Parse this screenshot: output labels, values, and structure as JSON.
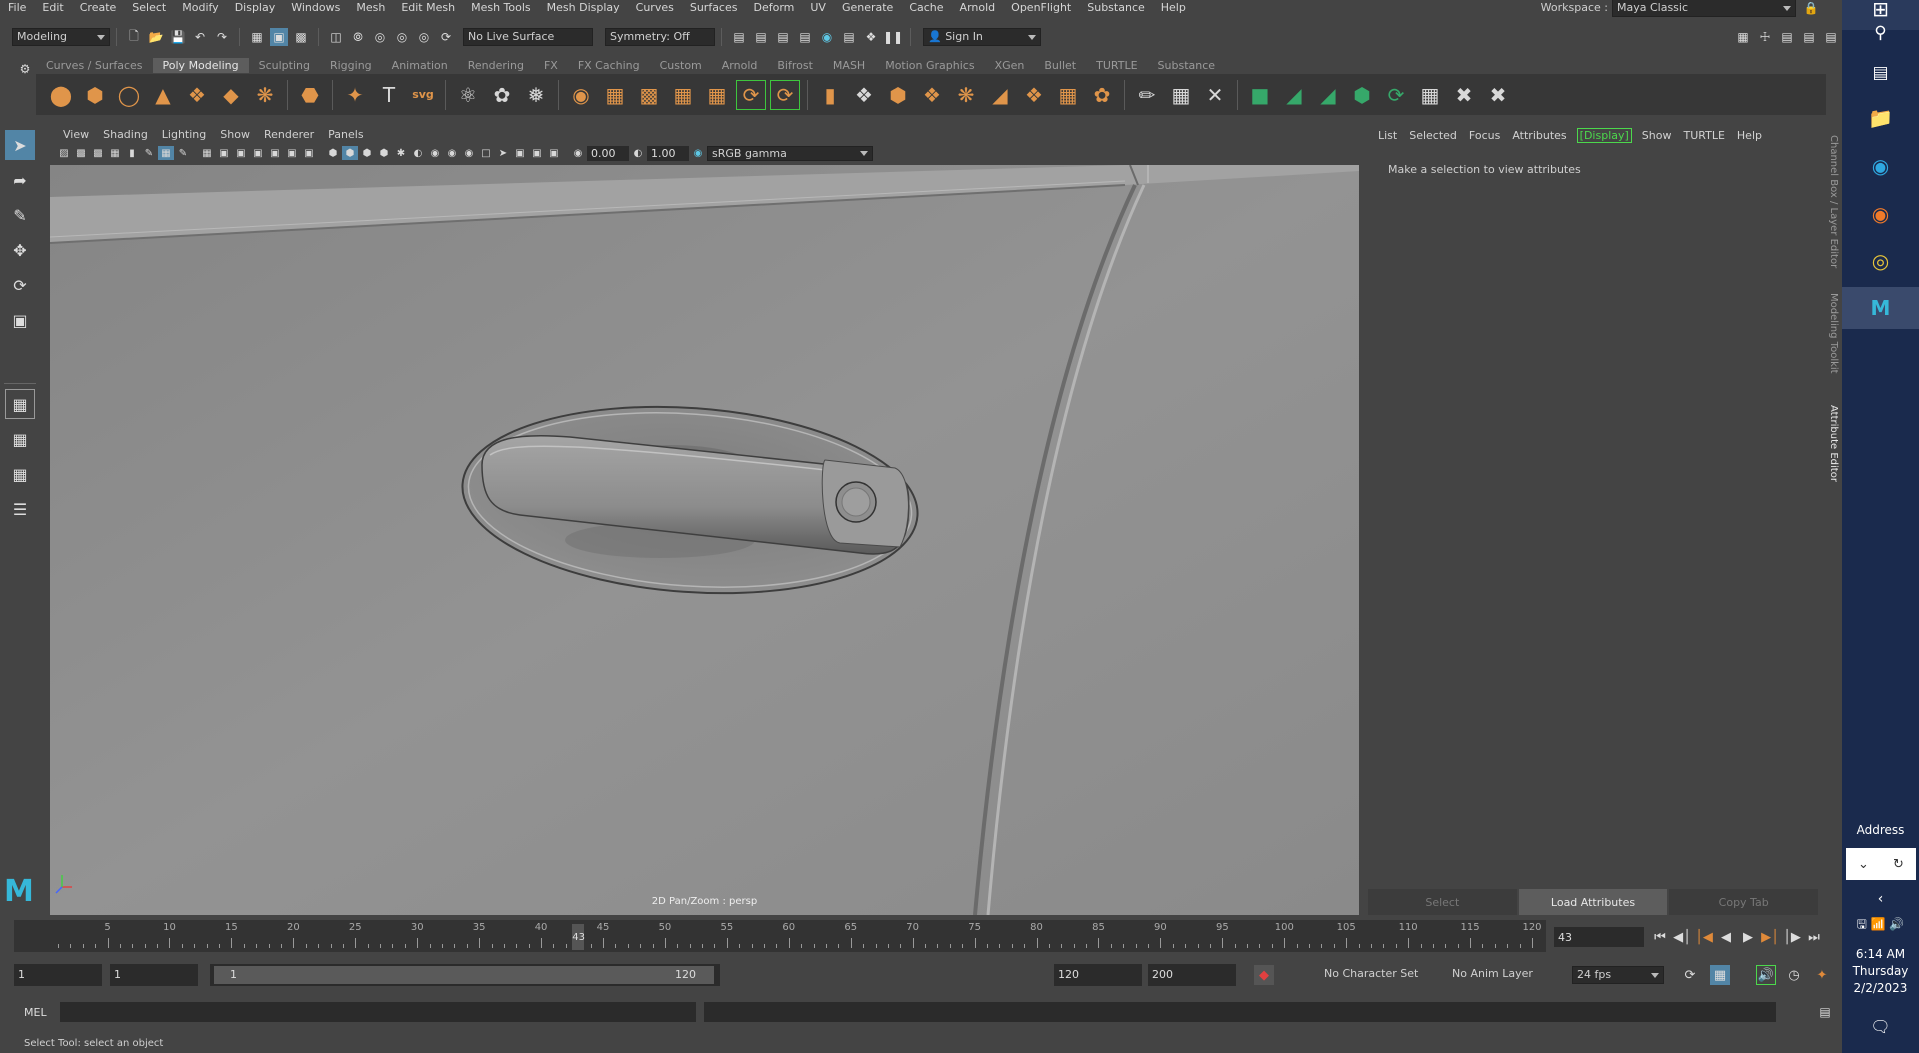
{
  "menubar": {
    "items": [
      "File",
      "Edit",
      "Create",
      "Select",
      "Modify",
      "Display",
      "Windows",
      "Mesh",
      "Edit Mesh",
      "Mesh Tools",
      "Mesh Display",
      "Curves",
      "Surfaces",
      "Deform",
      "UV",
      "Generate",
      "Cache",
      "Arnold",
      "OpenFlight",
      "Substance",
      "Help"
    ],
    "workspace_label": "Workspace :",
    "workspace_value": "Maya Classic"
  },
  "statusline": {
    "mode": "Modeling",
    "live_surface": "No Live Surface",
    "symmetry": "Symmetry: Off",
    "sign_in": "Sign In"
  },
  "shelf": {
    "tabs": [
      "Curves / Surfaces",
      "Poly Modeling",
      "Sculpting",
      "Rigging",
      "Animation",
      "Rendering",
      "FX",
      "FX Caching",
      "Custom",
      "Arnold",
      "Bifrost",
      "MASH",
      "Motion Graphics",
      "XGen",
      "Bullet",
      "TURTLE",
      "Substance"
    ],
    "active_tab": "Poly Modeling"
  },
  "viewport": {
    "menu": [
      "View",
      "Shading",
      "Lighting",
      "Show",
      "Renderer",
      "Panels"
    ],
    "exposure": "0.00",
    "gamma": "1.00",
    "color_space": "sRGB gamma",
    "label": "2D Pan/Zoom : persp"
  },
  "attribute_editor": {
    "menu": [
      "List",
      "Selected",
      "Focus",
      "Attributes",
      "[Display]",
      "Show",
      "TURTLE",
      "Help"
    ],
    "message": "Make a selection to view attributes",
    "buttons": [
      "Select",
      "Load Attributes",
      "Copy Tab"
    ],
    "side_tabs": [
      "Channel Box / Layer Editor",
      "Modeling Toolkit",
      "Attribute Editor"
    ]
  },
  "timeline": {
    "labels": [
      "5",
      "10",
      "15",
      "20",
      "25",
      "30",
      "35",
      "40",
      "45",
      "50",
      "55",
      "60",
      "65",
      "70",
      "75",
      "80",
      "85",
      "90",
      "95",
      "100",
      "105",
      "110",
      "115",
      "120"
    ],
    "current_frame": "43",
    "current_frame_field": "43"
  },
  "range": {
    "start": "1",
    "playback_start": "1",
    "slider_start": "1",
    "slider_end": "120",
    "playback_end": "120",
    "end": "200",
    "character_set": "No Character Set",
    "anim_layer": "No Anim Layer",
    "fps": "24 fps"
  },
  "command": {
    "lang": "MEL",
    "help": "Select Tool: select an object"
  },
  "taskbar": {
    "address_label": "Address",
    "time": "6:14 AM",
    "day": "Thursday",
    "date": "2/2/2023"
  }
}
